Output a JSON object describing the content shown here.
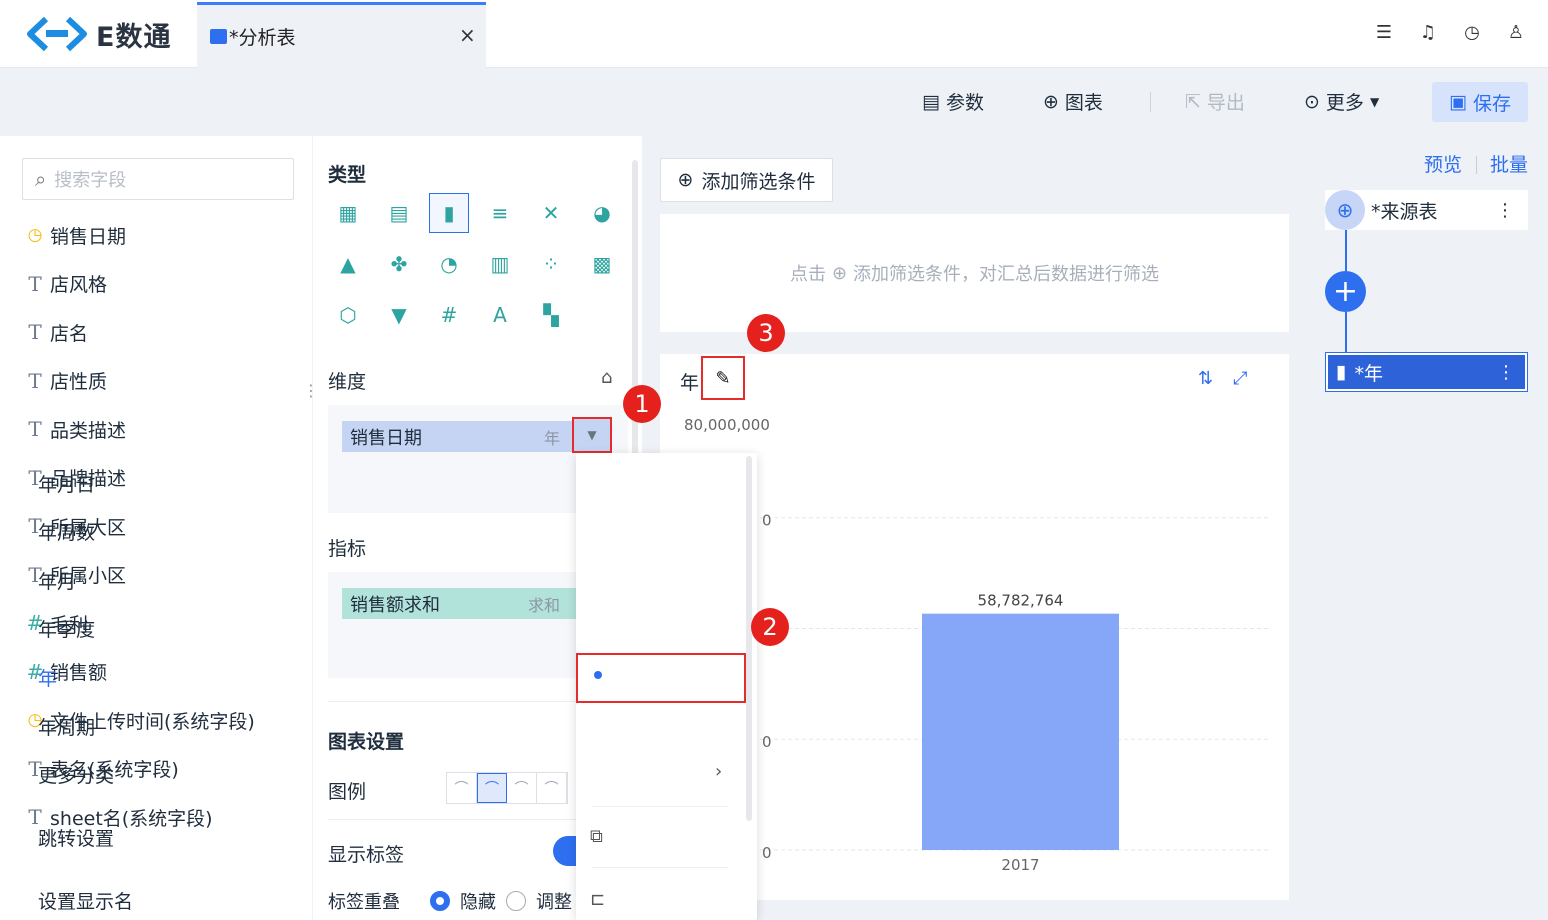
{
  "app": {
    "name": "E数通"
  },
  "tab": {
    "title": "*分析表",
    "close": "×"
  },
  "top_icons": [
    "checklist-icon",
    "bell-icon",
    "timer-icon",
    "user-icon"
  ],
  "toolbar": {
    "params": "参数",
    "chart": "图表",
    "export": "导出",
    "more": "更多",
    "save": "保存"
  },
  "fields": {
    "search_placeholder": "搜索字段",
    "items": [
      {
        "icon": "date",
        "label": "销售日期"
      },
      {
        "icon": "text",
        "label": "店风格"
      },
      {
        "icon": "text",
        "label": "店名"
      },
      {
        "icon": "text",
        "label": "店性质"
      },
      {
        "icon": "text",
        "label": "品类描述"
      },
      {
        "icon": "text",
        "label": "品牌描述"
      },
      {
        "icon": "text",
        "label": "所属大区"
      },
      {
        "icon": "text",
        "label": "所属小区"
      },
      {
        "icon": "number",
        "label": "毛利"
      },
      {
        "icon": "number",
        "label": "销售额"
      },
      {
        "icon": "date",
        "label": "文件上传时间(系统字段)"
      },
      {
        "icon": "text",
        "label": "表名(系统字段)"
      },
      {
        "icon": "text",
        "label": "sheet名(系统字段)"
      }
    ]
  },
  "config": {
    "type_title": "类型",
    "dimension_title": "维度",
    "dimension_pill": {
      "label": "销售日期",
      "suffix": "年"
    },
    "measure_title": "指标",
    "measure_pill": {
      "label": "销售额求和",
      "suffix": "求和"
    },
    "chart_settings_title": "图表设置",
    "legend_label": "图例",
    "show_label": "显示标签",
    "label_overlap": "标签重叠",
    "radio_hide": "隐藏",
    "radio_adjust": "调整"
  },
  "filter": {
    "button": "添加筛选条件",
    "hint_prefix": "点击",
    "hint_suffix": "添加筛选条件，对汇总后数据进行筛选"
  },
  "chart_card": {
    "title": "年"
  },
  "chart_data": {
    "type": "bar",
    "categories": [
      "2017"
    ],
    "values": [
      58782764
    ],
    "data_labels": [
      "58,782,764"
    ],
    "y_tick_labels": [
      "80,000,000",
      "0",
      "0",
      "0",
      "0"
    ],
    "ylim": [
      0,
      80000000
    ],
    "bar_color": "#86a6f7"
  },
  "dropdown": {
    "items": [
      "年月日",
      "年周数",
      "年月",
      "年季度",
      "年",
      "年周期",
      "更多分类"
    ],
    "selected": "年",
    "jump": "跳转设置",
    "display_name": "设置显示名"
  },
  "right": {
    "preview": "预览",
    "batch": "批量",
    "source": "*来源表",
    "step": "*年"
  },
  "badges": [
    "1",
    "2",
    "3"
  ],
  "colors": {
    "accent": "#2e6ff0",
    "badge": "#e5211d",
    "bar": "#86a6f7"
  }
}
